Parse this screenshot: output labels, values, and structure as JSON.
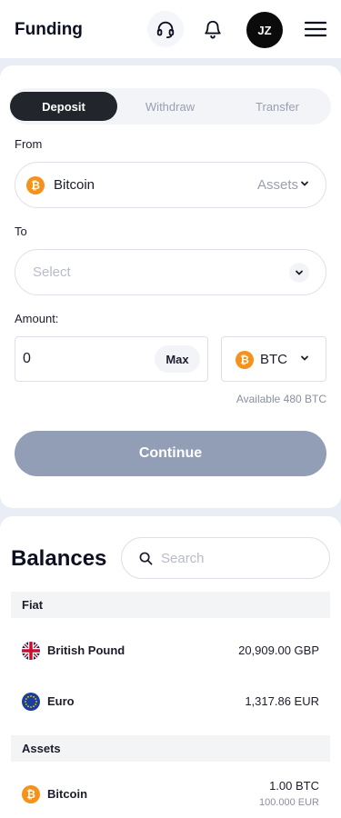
{
  "header": {
    "title": "Funding",
    "avatar_initials": "JZ",
    "icons": [
      "headset-icon",
      "bell-icon",
      "menu-icon"
    ]
  },
  "tabs": [
    {
      "label": "Deposit",
      "active": true
    },
    {
      "label": "Withdraw",
      "active": false
    },
    {
      "label": "Transfer",
      "active": false
    }
  ],
  "form": {
    "from_label": "From",
    "from_value": "Bitcoin",
    "from_type": "Assets",
    "to_label": "To",
    "to_placeholder": "Select",
    "amount_label": "Amount:",
    "amount_value": "0",
    "max_label": "Max",
    "currency": "BTC",
    "available": "Available 480 BTC",
    "continue_label": "Continue"
  },
  "balances": {
    "title": "Balances",
    "search_placeholder": "Search",
    "fiat_label": "Fiat",
    "assets_label": "Assets",
    "fiat": [
      {
        "name": "British Pound",
        "amount": "20,909.00 GBP",
        "icon": "uk-flag-icon"
      },
      {
        "name": "Euro",
        "amount": "1,317.86 EUR",
        "icon": "eu-flag-icon"
      }
    ],
    "assets": [
      {
        "name": "Bitcoin",
        "amount": "1.00 BTC",
        "sub_amount": "100.000 EUR",
        "icon": "bitcoin-icon"
      }
    ]
  },
  "colors": {
    "page_bg": "#e9edf5",
    "active_tab": "#23252c",
    "continue_disabled": "#929db6",
    "bitcoin": "#f5921b"
  }
}
